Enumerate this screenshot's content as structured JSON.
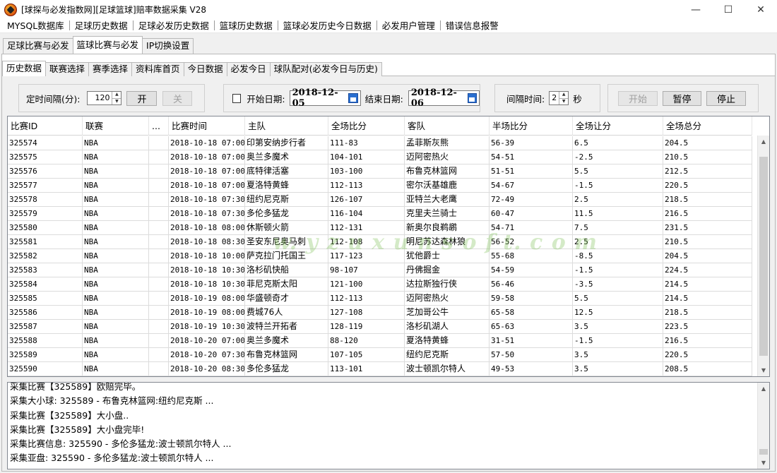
{
  "window": {
    "title": "[球探与必发指数网][足球篮球]赔率数据采集 V28",
    "minimize": "—",
    "maximize": "☐",
    "close": "✕"
  },
  "menu": [
    "MYSQL数据库",
    "足球历史数据",
    "足球必发历史数据",
    "篮球历史数据",
    "篮球必发历史今日数据",
    "必发用户管理",
    "错误信息报警"
  ],
  "tabs_main": [
    {
      "label": "足球比赛与必发",
      "active": false
    },
    {
      "label": "篮球比赛与必发",
      "active": true
    },
    {
      "label": "IP切换设置",
      "active": false
    }
  ],
  "tabs_sub": [
    {
      "label": "历史数据",
      "active": true
    },
    {
      "label": "联赛选择",
      "active": false
    },
    {
      "label": "赛季选择",
      "active": false
    },
    {
      "label": "资料库首页",
      "active": false
    },
    {
      "label": "今日数据",
      "active": false
    },
    {
      "label": "必发今日",
      "active": false
    },
    {
      "label": "球队配对(必发今日与历史)",
      "active": false
    }
  ],
  "controls": {
    "interval_label": "定时间隔(分):",
    "interval_value": "120",
    "open_btn": "开",
    "close_btn": "关",
    "start_date_label": "开始日期:",
    "start_date": "2018-12-05",
    "end_date_label": "结束日期:",
    "end_date": "2018-12-06",
    "gap_label": "间隔时间:",
    "gap_value": "2",
    "gap_unit": "秒",
    "start_btn": "开始",
    "pause_btn": "暂停",
    "stop_btn": "停止"
  },
  "table": {
    "columns": [
      "比赛ID",
      "联赛",
      "...",
      "比赛时间",
      "主队",
      "全场比分",
      "客队",
      "半场比分",
      "全场让分",
      "全场总分"
    ],
    "rows": [
      [
        "325574",
        "NBA",
        "",
        "2018-10-18 07:00",
        "印第安纳步行者",
        "111-83",
        "孟菲斯灰熊",
        "56-39",
        "6.5",
        "204.5"
      ],
      [
        "325575",
        "NBA",
        "",
        "2018-10-18 07:00",
        "奥兰多魔术",
        "104-101",
        "迈阿密热火",
        "54-51",
        "-2.5",
        "210.5"
      ],
      [
        "325576",
        "NBA",
        "",
        "2018-10-18 07:00",
        "底特律活塞",
        "103-100",
        "布鲁克林篮网",
        "51-51",
        "5.5",
        "212.5"
      ],
      [
        "325577",
        "NBA",
        "",
        "2018-10-18 07:00",
        "夏洛特黄蜂",
        "112-113",
        "密尔沃基雄鹿",
        "54-67",
        "-1.5",
        "220.5"
      ],
      [
        "325578",
        "NBA",
        "",
        "2018-10-18 07:30",
        "纽约尼克斯",
        "126-107",
        "亚特兰大老鹰",
        "72-49",
        "2.5",
        "218.5"
      ],
      [
        "325579",
        "NBA",
        "",
        "2018-10-18 07:30",
        "多伦多猛龙",
        "116-104",
        "克里夫兰骑士",
        "60-47",
        "11.5",
        "216.5"
      ],
      [
        "325580",
        "NBA",
        "",
        "2018-10-18 08:00",
        "休斯顿火箭",
        "112-131",
        "新奥尔良鹈鹕",
        "54-71",
        "7.5",
        "231.5"
      ],
      [
        "325581",
        "NBA",
        "",
        "2018-10-18 08:30",
        "圣安东尼奥马刺",
        "112-108",
        "明尼苏达森林狼",
        "56-52",
        "2.5",
        "210.5"
      ],
      [
        "325582",
        "NBA",
        "",
        "2018-10-18 10:00",
        "萨克拉门托国王",
        "117-123",
        "犹他爵士",
        "55-68",
        "-8.5",
        "204.5"
      ],
      [
        "325583",
        "NBA",
        "",
        "2018-10-18 10:30",
        "洛杉矶快船",
        "98-107",
        "丹佛掘金",
        "54-59",
        "-1.5",
        "224.5"
      ],
      [
        "325584",
        "NBA",
        "",
        "2018-10-18 10:30",
        "菲尼克斯太阳",
        "121-100",
        "达拉斯独行侠",
        "56-46",
        "-3.5",
        "214.5"
      ],
      [
        "325585",
        "NBA",
        "",
        "2018-10-19 08:00",
        "华盛顿奇才",
        "112-113",
        "迈阿密热火",
        "59-58",
        "5.5",
        "214.5"
      ],
      [
        "325586",
        "NBA",
        "",
        "2018-10-19 08:00",
        "费城76人",
        "127-108",
        "芝加哥公牛",
        "65-58",
        "12.5",
        "218.5"
      ],
      [
        "325587",
        "NBA",
        "",
        "2018-10-19 10:30",
        "波特兰开拓者",
        "128-119",
        "洛杉矶湖人",
        "65-63",
        "3.5",
        "223.5"
      ],
      [
        "325588",
        "NBA",
        "",
        "2018-10-20 07:00",
        "奥兰多魔术",
        "88-120",
        "夏洛特黄蜂",
        "31-51",
        "-1.5",
        "216.5"
      ],
      [
        "325589",
        "NBA",
        "",
        "2018-10-20 07:30",
        "布鲁克林篮网",
        "107-105",
        "纽约尼克斯",
        "57-50",
        "3.5",
        "220.5"
      ],
      [
        "325590",
        "NBA",
        "",
        "2018-10-20 08:30",
        "多伦多猛龙",
        "113-101",
        "波士顿凯尔特人",
        "49-53",
        "3.5",
        "208.5"
      ]
    ]
  },
  "log": [
    "采集比赛【325589】欧赔完毕。",
    "采集大小球:  325589 - 布鲁克林篮网:纽约尼克斯 ...",
    "采集比赛【325589】大小盘..",
    "采集比赛【325589】大小盘完毕!",
    "采集比赛信息:  325590 - 多伦多猛龙:波士顿凯尔特人 ...",
    "采集亚盘:  325590 - 多伦多猛龙:波士顿凯尔特人 ..."
  ],
  "watermark": "w. y z u x u n s o f t. c o m",
  "icons": {
    "app": "basketball-app-icon",
    "scroll_up": "▲",
    "scroll_down": "▼",
    "spin_up": "▲",
    "spin_down": "▼"
  }
}
